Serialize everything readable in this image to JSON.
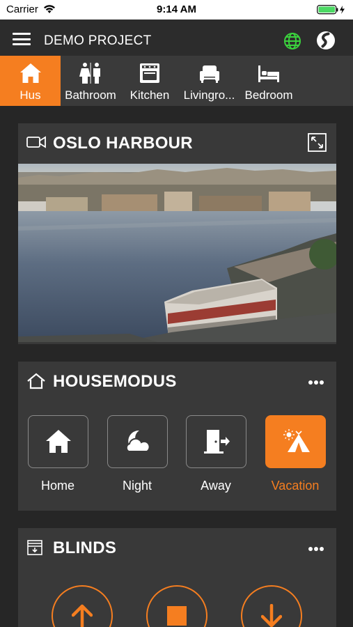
{
  "status_bar": {
    "carrier": "Carrier",
    "time": "9:14 AM"
  },
  "header": {
    "title": "DEMO PROJECT",
    "globe_icon": "globe-icon",
    "brand_icon": "brand-logo-icon"
  },
  "rooms": [
    {
      "label": "Hus",
      "icon": "house-icon",
      "active": true
    },
    {
      "label": "Bathroom",
      "icon": "restroom-icon",
      "active": false
    },
    {
      "label": "Kitchen",
      "icon": "oven-icon",
      "active": false
    },
    {
      "label": "Livingro...",
      "icon": "armchair-icon",
      "active": false
    },
    {
      "label": "Bedroom",
      "icon": "bed-icon",
      "active": false
    }
  ],
  "camera": {
    "title": "OSLO HARBOUR",
    "icon": "video-camera-icon"
  },
  "housemodus": {
    "title": "HOUSEMODUS",
    "modes": [
      {
        "label": "Home",
        "icon": "house-icon",
        "active": false
      },
      {
        "label": "Night",
        "icon": "moon-cloud-icon",
        "active": false
      },
      {
        "label": "Away",
        "icon": "door-exit-icon",
        "active": false
      },
      {
        "label": "Vacation",
        "icon": "tent-sun-icon",
        "active": true
      }
    ]
  },
  "blinds": {
    "title": "BLINDS",
    "buttons": [
      {
        "icon": "arrow-up-icon"
      },
      {
        "icon": "stop-icon"
      },
      {
        "icon": "arrow-down-icon"
      }
    ]
  },
  "colors": {
    "accent": "#f57e20",
    "background": "#262626",
    "card": "#393939",
    "tabbar": "#3a3a3a"
  }
}
